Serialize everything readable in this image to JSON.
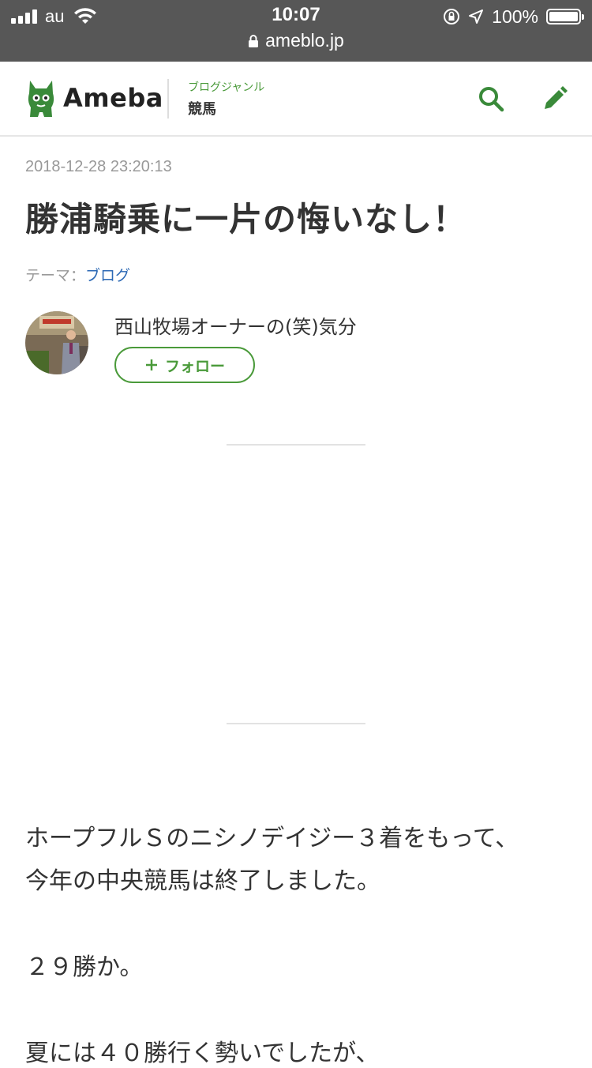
{
  "status_bar": {
    "carrier": "au",
    "time": "10:07",
    "battery_percent": "100%",
    "battery_level": 1.0,
    "url": "ameblo.jp"
  },
  "header": {
    "logo_text": "Ameba",
    "genre_label": "ブログジャンル",
    "genre_value": "競馬",
    "search_icon": "search-icon",
    "edit_icon": "pencil-icon",
    "brand_color": "#4a9a3a"
  },
  "article": {
    "date": "2018-12-28 23:20:13",
    "title": "勝浦騎乗に一片の悔いなし！",
    "theme_label": "テーマ：",
    "theme_value": "ブログ",
    "author": "西山牧場オーナーの(笑)気分",
    "follow_label": "フォロー",
    "paragraphs": [
      "ホープフルＳのニシノデイジー３着をもって、",
      "今年の中央競馬は終了しました。",
      "２９勝か。",
      "夏には４０勝行く勢いでしたが、"
    ]
  }
}
